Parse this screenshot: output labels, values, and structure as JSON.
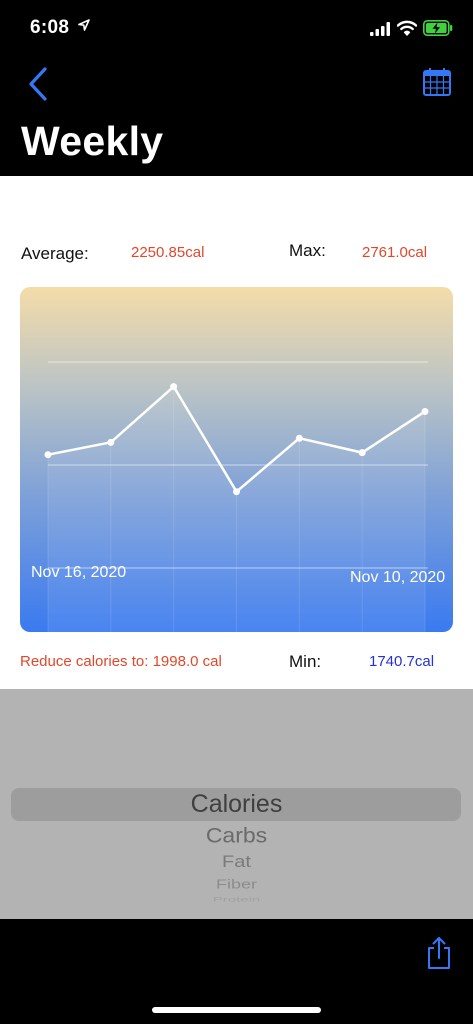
{
  "status": {
    "time": "6:08"
  },
  "nav": {
    "title": "Weekly"
  },
  "stats": {
    "average_label": "Average:",
    "average_value": "2250.85cal",
    "max_label": "Max:",
    "max_value": "2761.0cal",
    "reduce_text": "Reduce calories to: 1998.0 cal",
    "min_label": "Min:",
    "min_value": "1740.7cal"
  },
  "colors": {
    "accent": "#3478f6",
    "warning": "#e0482a",
    "min_value": "#2431d6"
  },
  "chart_data": {
    "type": "line",
    "x_tick_labels": [
      "Nov 16, 2020",
      "Nov 10, 2020"
    ],
    "values": [
      2100,
      2220,
      2761,
      1740.7,
      2260,
      2120,
      2520
    ],
    "ylim": [
      1000,
      3000
    ],
    "grid": true
  },
  "picker": {
    "items": [
      "Calories",
      "Carbs",
      "Fat",
      "Fiber",
      "Protein"
    ],
    "selected": "Calories"
  }
}
